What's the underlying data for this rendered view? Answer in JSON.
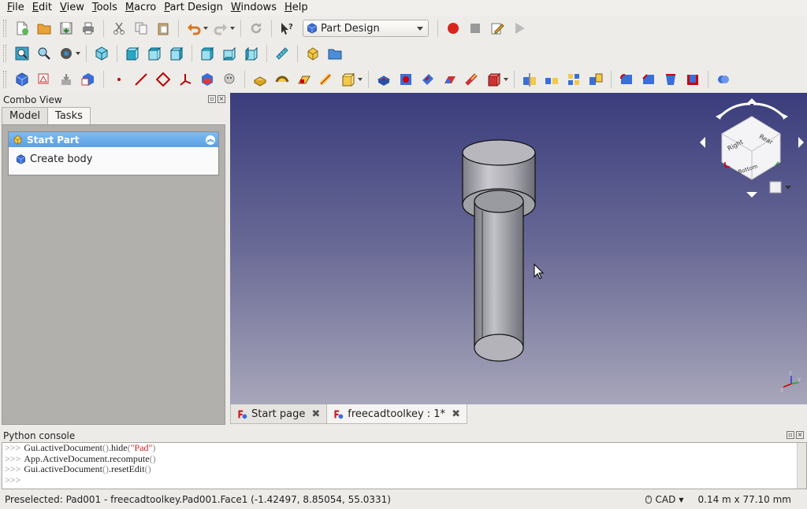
{
  "menu": [
    "File",
    "Edit",
    "View",
    "Tools",
    "Macro",
    "Part Design",
    "Windows",
    "Help"
  ],
  "toolbar": {
    "workbench": "Part Design"
  },
  "combo": {
    "title": "Combo View",
    "tabs": [
      "Model",
      "Tasks"
    ],
    "task_header": "Start Part",
    "task_item": "Create body"
  },
  "navcube": {
    "faces": [
      "Right",
      "Rear",
      "Bottom"
    ]
  },
  "doc_tabs": [
    "Start page",
    "freecadtoolkey : 1*"
  ],
  "console": {
    "title": "Python console",
    "lines": [
      {
        "prompt": ">>>",
        "obj": "Gui.activeDocument",
        "call": ".hide",
        "arg": "\"Pad\""
      },
      {
        "prompt": ">>>",
        "obj": "App.ActiveDocument.recompute",
        "call": "",
        "arg": ""
      },
      {
        "prompt": ">>>",
        "obj": "Gui.activeDocument",
        "call": ".resetEdit",
        "arg": ""
      },
      {
        "prompt": ">>>",
        "obj": "",
        "call": "",
        "arg": ""
      }
    ]
  },
  "status": {
    "text": "Preselected: Pad001 - freecadtoolkey.Pad001.Face1 (-1.42497, 8.85054, 55.0331)",
    "nav_style": "CAD",
    "units": "0.14 m x 77.10 mm"
  },
  "colors": {
    "bg_top": "#3a3c7c",
    "bg_bottom": "#a7a6ba",
    "task_header": "#5a9fe3"
  }
}
